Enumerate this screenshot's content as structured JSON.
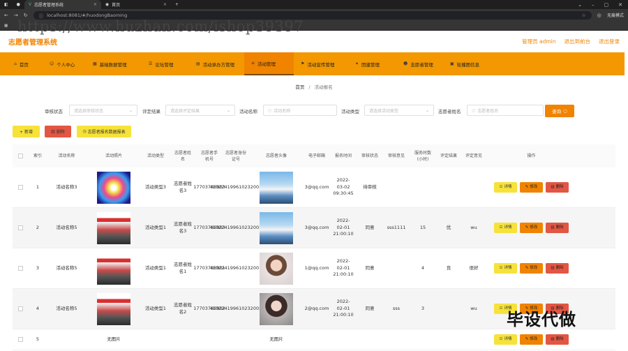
{
  "browser": {
    "tabs": [
      {
        "label": "志愿者管理系统",
        "active": true
      },
      {
        "label": "首页",
        "active": false
      }
    ],
    "url": "localhost:8081/#/huodongBaoming",
    "incognito": "无痕模式"
  },
  "watermark": "https://www.huzhan.com/ishop39397",
  "watermark2": "毕设代做",
  "header": {
    "title": "志愿者管理系统",
    "links": [
      "管理员 admin",
      "退出到前台",
      "退出登录"
    ]
  },
  "nav": [
    "首页",
    "个人中心",
    "基础数据管理",
    "论坛管理",
    "活动承办方管理",
    "活动管理",
    "活动宣传管理",
    "团建管理",
    "志愿者管理",
    "轮播图信息"
  ],
  "breadcrumb": {
    "home": "首页",
    "sep": "/",
    "current": "活动报名"
  },
  "filters": {
    "status_label": "审核状态",
    "status_placeholder": "请选择审核状态",
    "result_label": "评定结果",
    "result_placeholder": "请选择评定结果",
    "name_label": "活动名称",
    "name_placeholder": "活动名称",
    "type_label": "活动类型",
    "type_placeholder": "请选择活动类型",
    "volunteer_label": "志愿者姓名",
    "volunteer_placeholder": "志愿者姓名",
    "search_label": "查询"
  },
  "actions": {
    "add": "+ 新增",
    "delete": "删除",
    "report": "志愿者报名数据报表"
  },
  "columns": [
    "索引",
    "活动名称",
    "活动照片",
    "活动类型",
    "志愿者姓名",
    "志愿者手机号",
    "志愿者身份证号",
    "志愿者头像",
    "电子邮箱",
    "报名时间",
    "审核状态",
    "审核意见",
    "服务时数(小时)",
    "评定结果",
    "评定意见",
    "操作"
  ],
  "row_buttons": {
    "detail": "详情",
    "edit": "修改",
    "delete": "删除"
  },
  "rows": [
    {
      "index": "1",
      "name": "活动名称3",
      "type": "活动类型3",
      "volunteer": "志愿者姓名3",
      "phone": "17703786903",
      "idcard": "410224199610232003",
      "email": "3@qq.com",
      "time": "2022-03-02 09:30:45",
      "status": "待审核",
      "opinion": "",
      "hours": "",
      "result": "",
      "comment": ""
    },
    {
      "index": "2",
      "name": "活动名称5",
      "type": "活动类型1",
      "volunteer": "志愿者姓名3",
      "phone": "17703786903",
      "idcard": "410224199610232003",
      "email": "3@qq.com",
      "time": "2022-02-01 21:00:10",
      "status": "同意",
      "opinion": "sss1111",
      "hours": "15",
      "result": "优",
      "comment": "wu"
    },
    {
      "index": "3",
      "name": "活动名称5",
      "type": "活动类型1",
      "volunteer": "志愿者姓名1",
      "phone": "17703786901",
      "idcard": "410224199610232001",
      "email": "1@qq.com",
      "time": "2022-02-01 21:00:10",
      "status": "同意",
      "opinion": "",
      "hours": "4",
      "result": "良",
      "comment": "很好"
    },
    {
      "index": "4",
      "name": "活动名称5",
      "type": "活动类型1",
      "volunteer": "志愿者姓名2",
      "phone": "17703786902",
      "idcard": "410224199610232002",
      "email": "2@qq.com",
      "time": "2022-02-01 21:00:10",
      "status": "同意",
      "opinion": "sss",
      "hours": "3",
      "result": "",
      "comment": "wu"
    },
    {
      "index": "5",
      "name": "",
      "photo_text": "无图片",
      "avatar_text": "无图片"
    }
  ]
}
